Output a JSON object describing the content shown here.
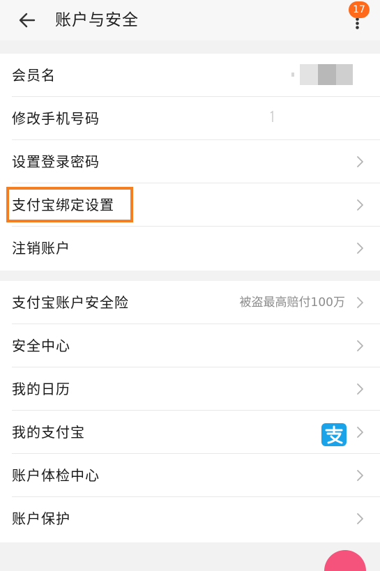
{
  "header": {
    "title": "账户与安全",
    "badge_count": "17",
    "back_icon": "arrow-left-icon",
    "more_icon": "more-vertical-icon"
  },
  "sections": [
    {
      "rows": [
        {
          "label": "会员名",
          "value": "",
          "has_chevron": false
        },
        {
          "label": "修改手机号码",
          "value": "",
          "has_chevron": false
        },
        {
          "label": "设置登录密码",
          "value": "",
          "has_chevron": true
        },
        {
          "label": "支付宝绑定设置",
          "value": "",
          "has_chevron": true,
          "highlighted": true
        },
        {
          "label": "注销账户",
          "value": "",
          "has_chevron": true
        }
      ]
    },
    {
      "rows": [
        {
          "label": "支付宝账户安全险",
          "value": "被盗最高赔付100万",
          "has_chevron": true
        },
        {
          "label": "安全中心",
          "value": "",
          "has_chevron": true
        },
        {
          "label": "我的日历",
          "value": "",
          "has_chevron": true
        },
        {
          "label": "我的支付宝",
          "value": "",
          "has_chevron": true,
          "icon": "alipay-icon"
        },
        {
          "label": "账户体检中心",
          "value": "",
          "has_chevron": true
        },
        {
          "label": "账户保护",
          "value": "",
          "has_chevron": true
        }
      ]
    }
  ],
  "colors": {
    "accent": "#ff6a1a",
    "highlight_border": "#f47e22",
    "alipay_blue": "#1aa3e8"
  }
}
